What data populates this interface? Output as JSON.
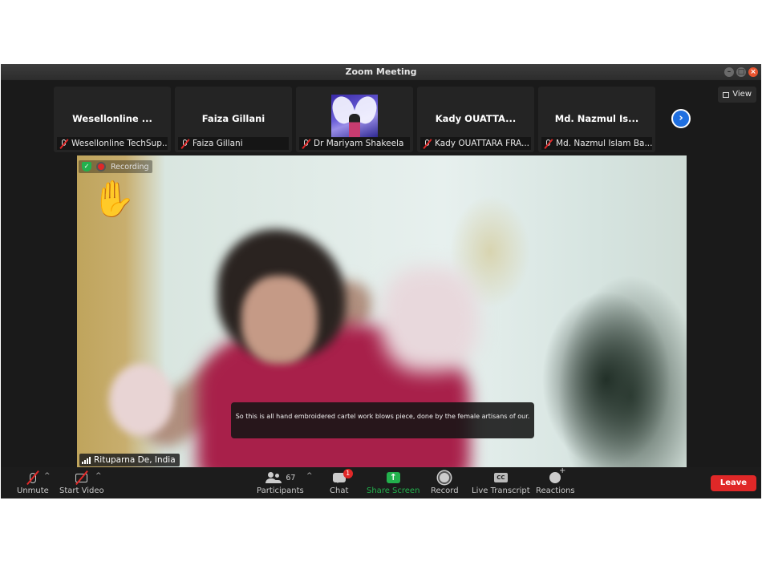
{
  "window": {
    "title": "Zoom Meeting"
  },
  "view_button": {
    "label": "View"
  },
  "thumbnails": [
    {
      "display_name": "Wesellonline ...",
      "label": "Wesellonline TechSup..."
    },
    {
      "display_name": "Faiza Gillani",
      "label": "Faiza Gillani"
    },
    {
      "display_name": "",
      "label": "Dr Mariyam Shakeela"
    },
    {
      "display_name": "Kady OUATTA...",
      "label": "Kady OUATTARA FRA..."
    },
    {
      "display_name": "Md. Nazmul Is...",
      "label": "Md. Nazmul Islam Ba..."
    }
  ],
  "main_video": {
    "recording_label": "Recording",
    "reaction_emoji": "✋",
    "speaker_name": "Rituparna De, India",
    "caption": "So this is all hand embroidered cartel work blows piece, done by the female artisans of our."
  },
  "toolbar": {
    "unmute": "Unmute",
    "start_video": "Start Video",
    "participants": "Participants",
    "participant_count": "67",
    "chat": "Chat",
    "chat_badge": "1",
    "share_screen": "Share Screen",
    "record": "Record",
    "live_transcript": "Live Transcript",
    "cc_icon": "CC",
    "reactions": "Reactions",
    "leave": "Leave"
  },
  "colors": {
    "leave": "#e02828",
    "share_screen": "#23b14d",
    "next_arrow": "#1f6fe0"
  }
}
